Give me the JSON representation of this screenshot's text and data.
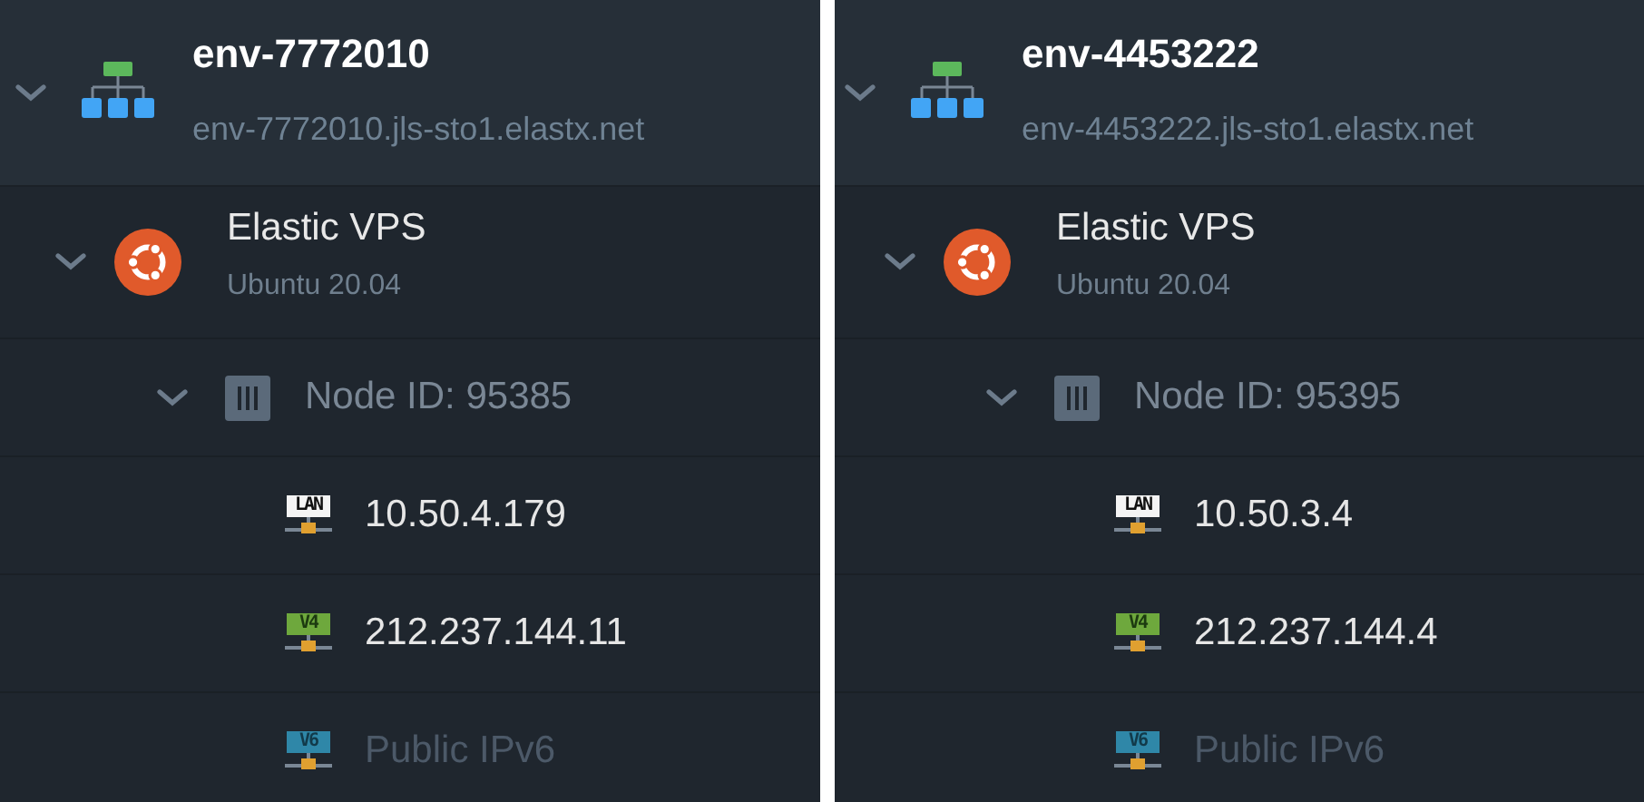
{
  "panels": [
    {
      "environment": {
        "name": "env-7772010",
        "domain": "env-7772010.jls-sto1.elastx.net",
        "expanded": true
      },
      "server": {
        "name": "Elastic VPS",
        "os": "Ubuntu 20.04",
        "expanded": true
      },
      "node": {
        "label": "Node ID: 95385",
        "expanded": true
      },
      "addresses": [
        {
          "kind": "lan",
          "tag": "LAN",
          "text": "10.50.4.179",
          "disabled": false
        },
        {
          "kind": "v4",
          "tag": "V4",
          "text": "212.237.144.11",
          "disabled": false
        },
        {
          "kind": "v6",
          "tag": "V6",
          "text": "Public IPv6",
          "disabled": true
        }
      ]
    },
    {
      "environment": {
        "name": "env-4453222",
        "domain": "env-4453222.jls-sto1.elastx.net",
        "expanded": true
      },
      "server": {
        "name": "Elastic VPS",
        "os": "Ubuntu 20.04",
        "expanded": true
      },
      "node": {
        "label": "Node ID: 95395",
        "expanded": true
      },
      "addresses": [
        {
          "kind": "lan",
          "tag": "LAN",
          "text": "10.50.3.4",
          "disabled": false
        },
        {
          "kind": "v4",
          "tag": "V4",
          "text": "212.237.144.4",
          "disabled": false
        },
        {
          "kind": "v6",
          "tag": "V6",
          "text": "Public IPv6",
          "disabled": true
        }
      ]
    }
  ]
}
